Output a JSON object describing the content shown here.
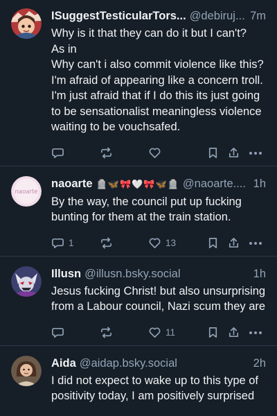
{
  "posts": [
    {
      "name": "ISuggestTesticularTors...",
      "handle": "@debiruj...",
      "time": "7m",
      "text": "Why is it that they can do it but I can't?\nAs in\nWhy can't i also commit violence like this?\nI'm afraid of appearing like a concern troll. I'm just afraid that if I do this its just going to be sensationalist meaningless violence waiting to be vouchsafed.",
      "reply_count": "",
      "like_count": ""
    },
    {
      "name": "naoarte",
      "emoji": "🪦🦋🎀🤍🎀🦋🪦",
      "handle": "@naoarte....",
      "time": "1h",
      "text": "By the way, the council put up fucking bunting for them at the train station.",
      "reply_count": "1",
      "like_count": "13",
      "avatar_text": "naoarte"
    },
    {
      "name": "Illusn",
      "handle": "@illusn.bsky.social",
      "time": "1h",
      "text": "Jesus fucking Christ! but also unsurprising from a Labour council, Nazi scum they are",
      "reply_count": "",
      "like_count": "11"
    },
    {
      "name": "Aida",
      "handle": "@aidap.bsky.social",
      "time": "2h",
      "text": "I did not expect to wake up to this type of positivity today, I am positively surprised",
      "reply_count": "",
      "like_count": ""
    }
  ],
  "icons": {
    "reply": "reply-icon",
    "repost": "repost-icon",
    "like": "heart-icon",
    "save": "bookmark-icon",
    "share": "share-icon",
    "more": "more-icon"
  },
  "colors": {
    "background": "#161e27",
    "divider": "#2c3a4a",
    "secondary_text": "#93a5b7"
  }
}
